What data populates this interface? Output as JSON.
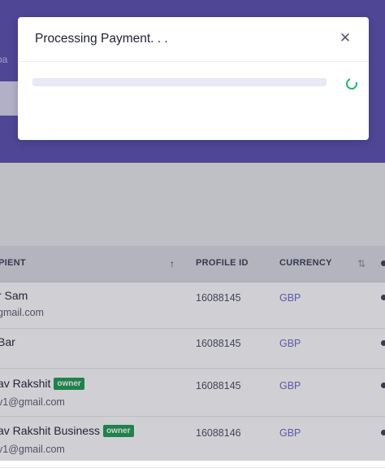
{
  "background": {
    "breadcrumb": "oa",
    "table": {
      "headers": {
        "recipient": "PIENT",
        "profile_id": "PROFILE ID",
        "currency": "CURRENCY"
      },
      "rows": [
        {
          "name": "r Sam",
          "email": "gmail.com",
          "badge": "",
          "profile_id": "16088145",
          "currency": "GBP"
        },
        {
          "name": "Bar",
          "email": "",
          "badge": "",
          "profile_id": "16088145",
          "currency": "GBP"
        },
        {
          "name": "av Rakshit",
          "email": "v1@gmail.com",
          "badge": "owner",
          "profile_id": "16088145",
          "currency": "GBP"
        },
        {
          "name": "av Rakshit Business",
          "email": "v1@gmail.com",
          "badge": "owner",
          "profile_id": "16088146",
          "currency": "GBP"
        }
      ]
    }
  },
  "modal": {
    "title": "Processing Payment. . .",
    "close_icon": "close-icon",
    "progress_fraction": 1.0,
    "spinner_icon": "loading-spinner-icon"
  },
  "colors": {
    "hero": "#5a4fb0",
    "spinner": "#1db96a",
    "badge": "#1d9c4f",
    "currency_link": "#6b67c9"
  }
}
